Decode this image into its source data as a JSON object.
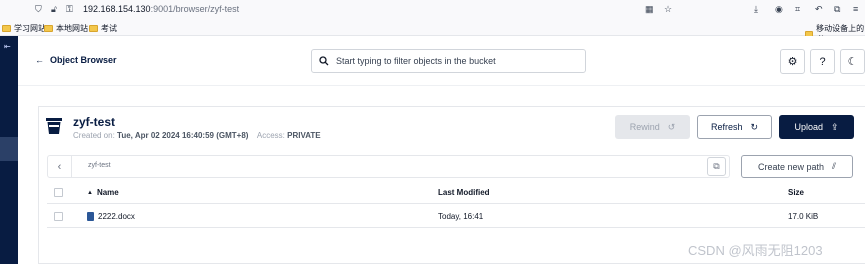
{
  "browser": {
    "url_host": "192.168.154.130",
    "url_rest": ":9001/browser/zyf-test",
    "bookmarks": [
      "学习网站",
      "本地网站",
      "考试"
    ],
    "mobile_bookmark": "移动设备上的书"
  },
  "header": {
    "back_label": "Object Browser",
    "search_placeholder": "Start typing to filter objects in the bucket"
  },
  "bucket": {
    "name": "zyf-test",
    "created_label": "Created on:",
    "created_value": "Tue, Apr 02 2024 16:40:59 (GMT+8)",
    "access_label": "Access:",
    "access_value": "PRIVATE"
  },
  "actions": {
    "rewind": "Rewind",
    "refresh": "Refresh",
    "upload": "Upload",
    "create_path": "Create new path"
  },
  "path": "zyf-test",
  "table": {
    "columns": [
      "Name",
      "Last Modified",
      "Size"
    ],
    "rows": [
      {
        "name": "2222.docx",
        "modified": "Today, 16:41",
        "size": "17.0 KiB"
      }
    ]
  },
  "watermark": "CSDN @风雨无阻1203"
}
